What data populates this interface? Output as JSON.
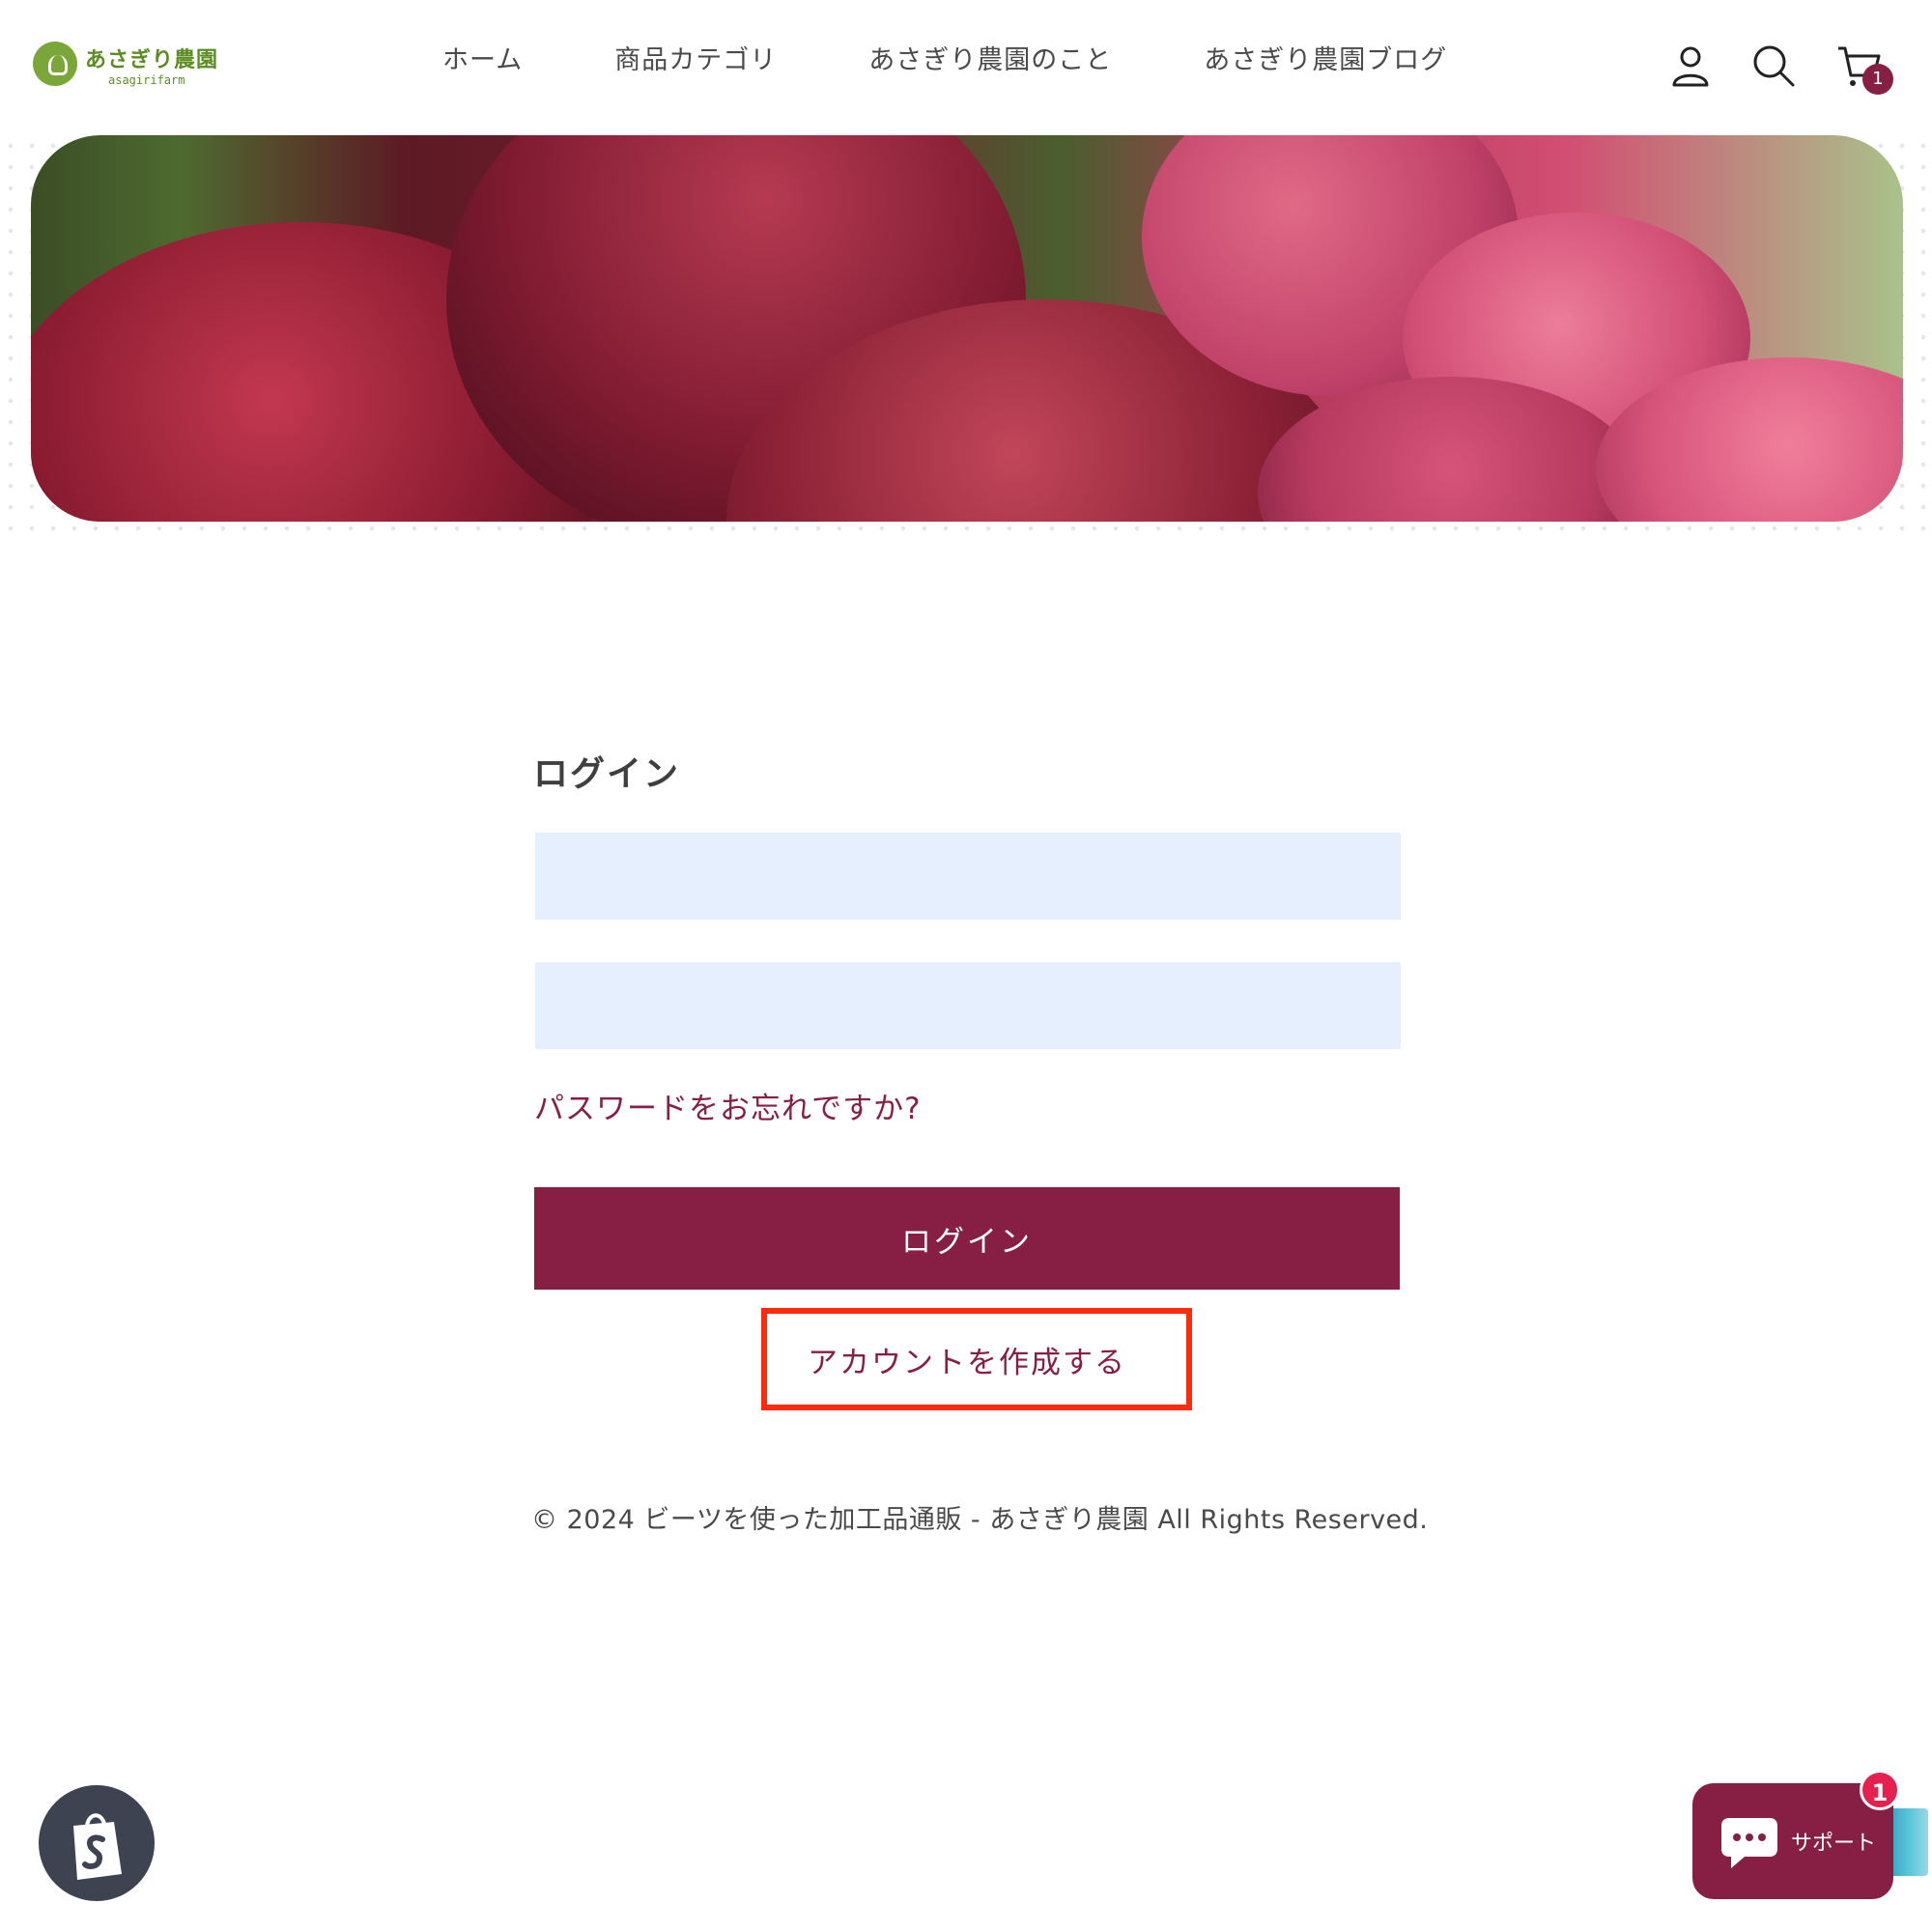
{
  "header": {
    "logo_text": "あさぎり農園",
    "logo_sub": "asagirifarm",
    "nav": [
      "ホーム",
      "商品カテゴリ",
      "あさぎり農園のこと",
      "あさぎり農園ブログ"
    ],
    "icons": [
      "account-icon",
      "search-icon",
      "cart-icon"
    ],
    "cart_count": "1"
  },
  "login": {
    "title": "ログイン",
    "email_value": "",
    "password_value": "",
    "forgot_label": "パスワードをお忘れですか?",
    "login_button": "ログイン",
    "create_account": "アカウントを作成する"
  },
  "footer": {
    "copyright": "© 2024 ビーツを使った加工品通販 - あさぎり農園 All Rights Reserved."
  },
  "widgets": {
    "support_label": "サポート",
    "support_badge": "1",
    "shopify_icon": "shopify-bag-icon",
    "chat_icon": "chat-bubble-icon"
  },
  "colors": {
    "brand": "#861f43",
    "field_bg": "#e6effd",
    "highlight": "#ff2a0c",
    "logo_green": "#5c8d23"
  }
}
